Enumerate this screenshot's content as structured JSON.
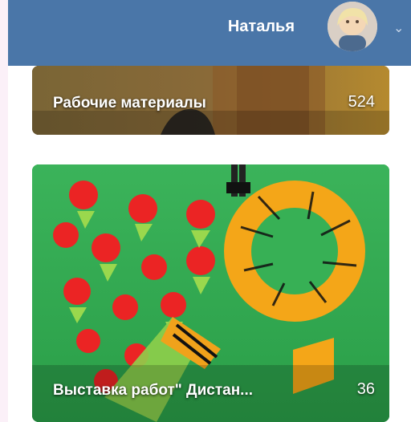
{
  "header": {
    "user_name": "Наталья"
  },
  "albums": [
    {
      "title": "Рабочие материалы",
      "count": "524"
    },
    {
      "title": "Выставка работ\" Дистан...",
      "count": "36"
    }
  ],
  "icons": {
    "chevron": "chevron-down-icon",
    "avatar": "avatar"
  }
}
